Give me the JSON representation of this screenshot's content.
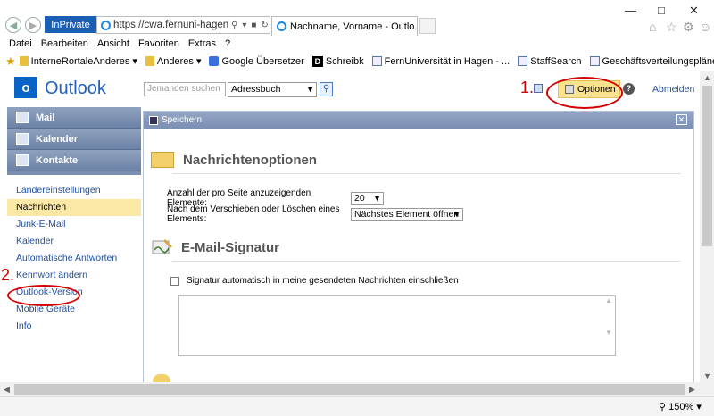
{
  "browser": {
    "inprivate": "InPrivate",
    "url": "https://cwa.fernuni-hagen.de/o",
    "tab_title": "Nachname, Vorname - Outlo...",
    "menu": [
      "Datei",
      "Bearbeiten",
      "Ansicht",
      "Favoriten",
      "Extras",
      "?"
    ],
    "favorites": [
      {
        "label": "InterneRortaleAnderes ▾",
        "icon": "folder"
      },
      {
        "label": "Anderes ▾",
        "icon": "folder"
      },
      {
        "label": "Google Übersetzer",
        "icon": "google"
      },
      {
        "label": "Schreibk",
        "icon": "d"
      },
      {
        "label": "FernUniversität in Hagen - ...",
        "icon": "fernuni"
      },
      {
        "label": "StaffSearch",
        "icon": "fernuni"
      },
      {
        "label": "Geschäftsverteilungspläne (...",
        "icon": "fernuni"
      }
    ],
    "zoom": "150%"
  },
  "header": {
    "app_name": "Outlook",
    "logo_letter": "o",
    "search_placeholder": "Jemanden suchen",
    "addressbook": "Adressbuch",
    "options_label": "Optionen",
    "logout_label": "Abmelden"
  },
  "annotations": {
    "one": "1.",
    "two": "2."
  },
  "nav": {
    "mail": "Mail",
    "calendar": "Kalender",
    "contacts": "Kontakte"
  },
  "sidebar": {
    "items": [
      {
        "label": "Ländereinstellungen",
        "active": false
      },
      {
        "label": "Nachrichten",
        "active": true
      },
      {
        "label": "Junk-E-Mail",
        "active": false
      },
      {
        "label": "Kalender",
        "active": false
      },
      {
        "label": "Automatische Antworten",
        "active": false
      },
      {
        "label": "Kennwort ändern",
        "active": false
      },
      {
        "label": "Outlook-Version",
        "active": false
      },
      {
        "label": "Mobile Geräte",
        "active": false
      },
      {
        "label": "Info",
        "active": false
      }
    ]
  },
  "main": {
    "save_label": "Speichern",
    "section1_title": "Nachrichtenoptionen",
    "items_per_page_label": "Anzahl der pro Seite anzuzeigenden Elemente:",
    "items_per_page_value": "20",
    "after_move_label": "Nach dem Verschieben oder Löschen eines Elements:",
    "after_move_value": "Nächstes Element öffnen",
    "section2_title": "E-Mail-Signatur",
    "signature_checkbox_label": "Signatur automatisch in meine gesendeten Nachrichten einschließen"
  }
}
